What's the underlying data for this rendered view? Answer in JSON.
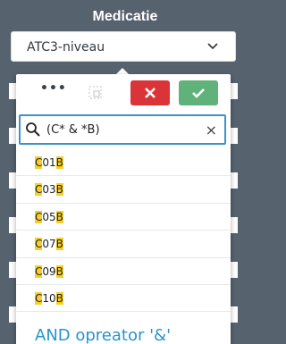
{
  "panel": {
    "title": "Medicatie",
    "select_value": "ATC3-niveau",
    "chevron_icon": "chevron-down-icon"
  },
  "toolbar": {
    "more_label": "•••",
    "more_icon": "more-icon",
    "select_all_icon": "select-all-icon",
    "cancel_icon": "close-icon",
    "confirm_icon": "check-icon",
    "cancel_color": "#da3438",
    "confirm_color": "#5fb37a"
  },
  "search": {
    "value": "(C* & *B)",
    "icon": "search-icon",
    "clear_label": "×",
    "border_color": "#3b93c9"
  },
  "results": [
    {
      "prefix": "C",
      "middle": "01",
      "suffix": "B"
    },
    {
      "prefix": "C",
      "middle": "03",
      "suffix": "B"
    },
    {
      "prefix": "C",
      "middle": "05",
      "suffix": "B"
    },
    {
      "prefix": "C",
      "middle": "07",
      "suffix": "B"
    },
    {
      "prefix": "C",
      "middle": "09",
      "suffix": "B"
    },
    {
      "prefix": "C",
      "middle": "10",
      "suffix": "B"
    }
  ],
  "highlight_color": "#f5cf28",
  "hint": "AND opreator '&'"
}
